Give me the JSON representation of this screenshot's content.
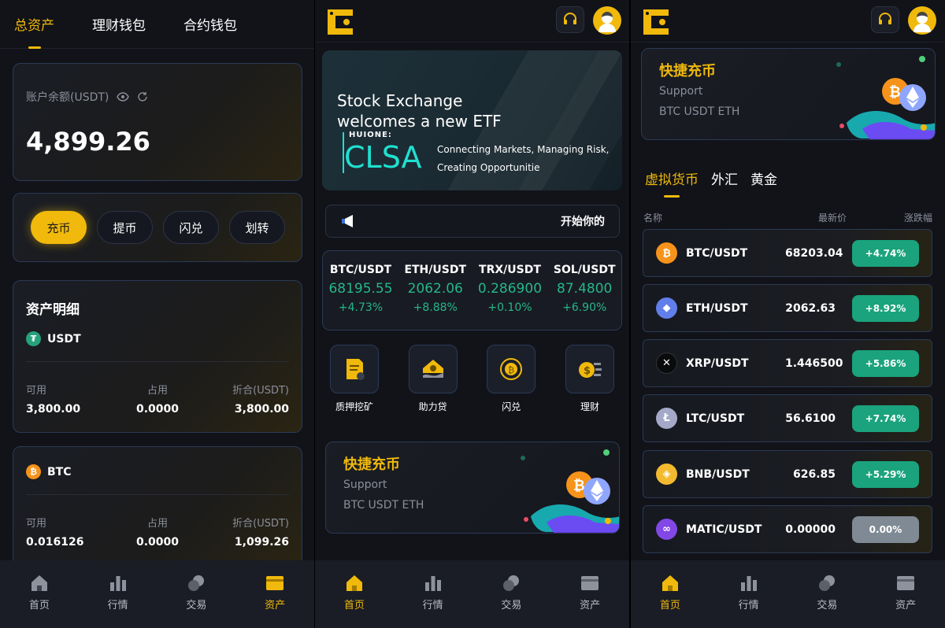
{
  "nav": {
    "items": [
      {
        "label": "首页",
        "icon": "home-icon"
      },
      {
        "label": "行情",
        "icon": "chart-icon"
      },
      {
        "label": "交易",
        "icon": "coins-icon"
      },
      {
        "label": "资产",
        "icon": "wallet-icon"
      }
    ]
  },
  "assets": {
    "tabs": [
      "总资产",
      "理财钱包",
      "合约钱包"
    ],
    "balance_label": "账户余额(USDT)",
    "balance": "4,899.26",
    "actions": [
      "充币",
      "提币",
      "闪兑",
      "划转"
    ],
    "details_title": "资产明细",
    "columns": [
      "可用",
      "占用",
      "折合(USDT)"
    ],
    "coins": [
      {
        "symbol": "USDT",
        "icon": "tether-icon",
        "color": "#26a17b",
        "available": "3,800.00",
        "frozen": "0.0000",
        "value": "3,800.00"
      },
      {
        "symbol": "BTC",
        "icon": "bitcoin-icon",
        "color": "#f7931a",
        "available": "0.016126",
        "frozen": "0.0000",
        "value": "1,099.26"
      }
    ]
  },
  "home": {
    "banner": {
      "line1": "Stock Exchange",
      "line2": "welcomes a new ETF",
      "brand": "HUIONE:",
      "ticker": "CLSA",
      "tag1": "Connecting Markets, Managing Risk,",
      "tag2": "Creating Opportunitie"
    },
    "notice": "开始你的",
    "tickers": [
      {
        "pair": "BTC/USDT",
        "price": "68195.55",
        "change": "+4.73%"
      },
      {
        "pair": "ETH/USDT",
        "price": "2062.06",
        "change": "+8.88%"
      },
      {
        "pair": "TRX/USDT",
        "price": "0.286900",
        "change": "+0.10%"
      },
      {
        "pair": "SOL/USDT",
        "price": "87.4800",
        "change": "+6.90%"
      }
    ],
    "quick": [
      {
        "label": "质押挖矿",
        "icon": "staking-icon"
      },
      {
        "label": "助力贷",
        "icon": "loan-icon"
      },
      {
        "label": "闪兑",
        "icon": "swap-icon"
      },
      {
        "label": "理财",
        "icon": "finance-icon"
      }
    ]
  },
  "promo": {
    "title": "快捷充币",
    "subtitle": "Support",
    "coins": "BTC USDT ETH"
  },
  "market": {
    "tabs": [
      "虚拟货币",
      "外汇",
      "黄金"
    ],
    "head": [
      "名称",
      "最新价",
      "涨跌幅"
    ],
    "rows": [
      {
        "pair": "BTC/USDT",
        "price": "68203.04",
        "change": "+4.74%",
        "icon": "bitcoin-icon",
        "color": "#f7931a",
        "glyph": "₿"
      },
      {
        "pair": "ETH/USDT",
        "price": "2062.63",
        "change": "+8.92%",
        "icon": "ethereum-icon",
        "color": "#627eea",
        "glyph": "◆"
      },
      {
        "pair": "XRP/USDT",
        "price": "1.446500",
        "change": "+5.86%",
        "icon": "xrp-icon",
        "color": "#0a0b0d",
        "glyph": "✕"
      },
      {
        "pair": "LTC/USDT",
        "price": "56.6100",
        "change": "+7.74%",
        "icon": "litecoin-icon",
        "color": "#a5a9c8",
        "glyph": "Ł"
      },
      {
        "pair": "BNB/USDT",
        "price": "626.85",
        "change": "+5.29%",
        "icon": "bnb-icon",
        "color": "#f3ba2f",
        "glyph": "◈"
      },
      {
        "pair": "MATIC/USDT",
        "price": "0.00000",
        "change": "0.00%",
        "icon": "polygon-icon",
        "color": "#8247e5",
        "glyph": "∞"
      }
    ]
  }
}
